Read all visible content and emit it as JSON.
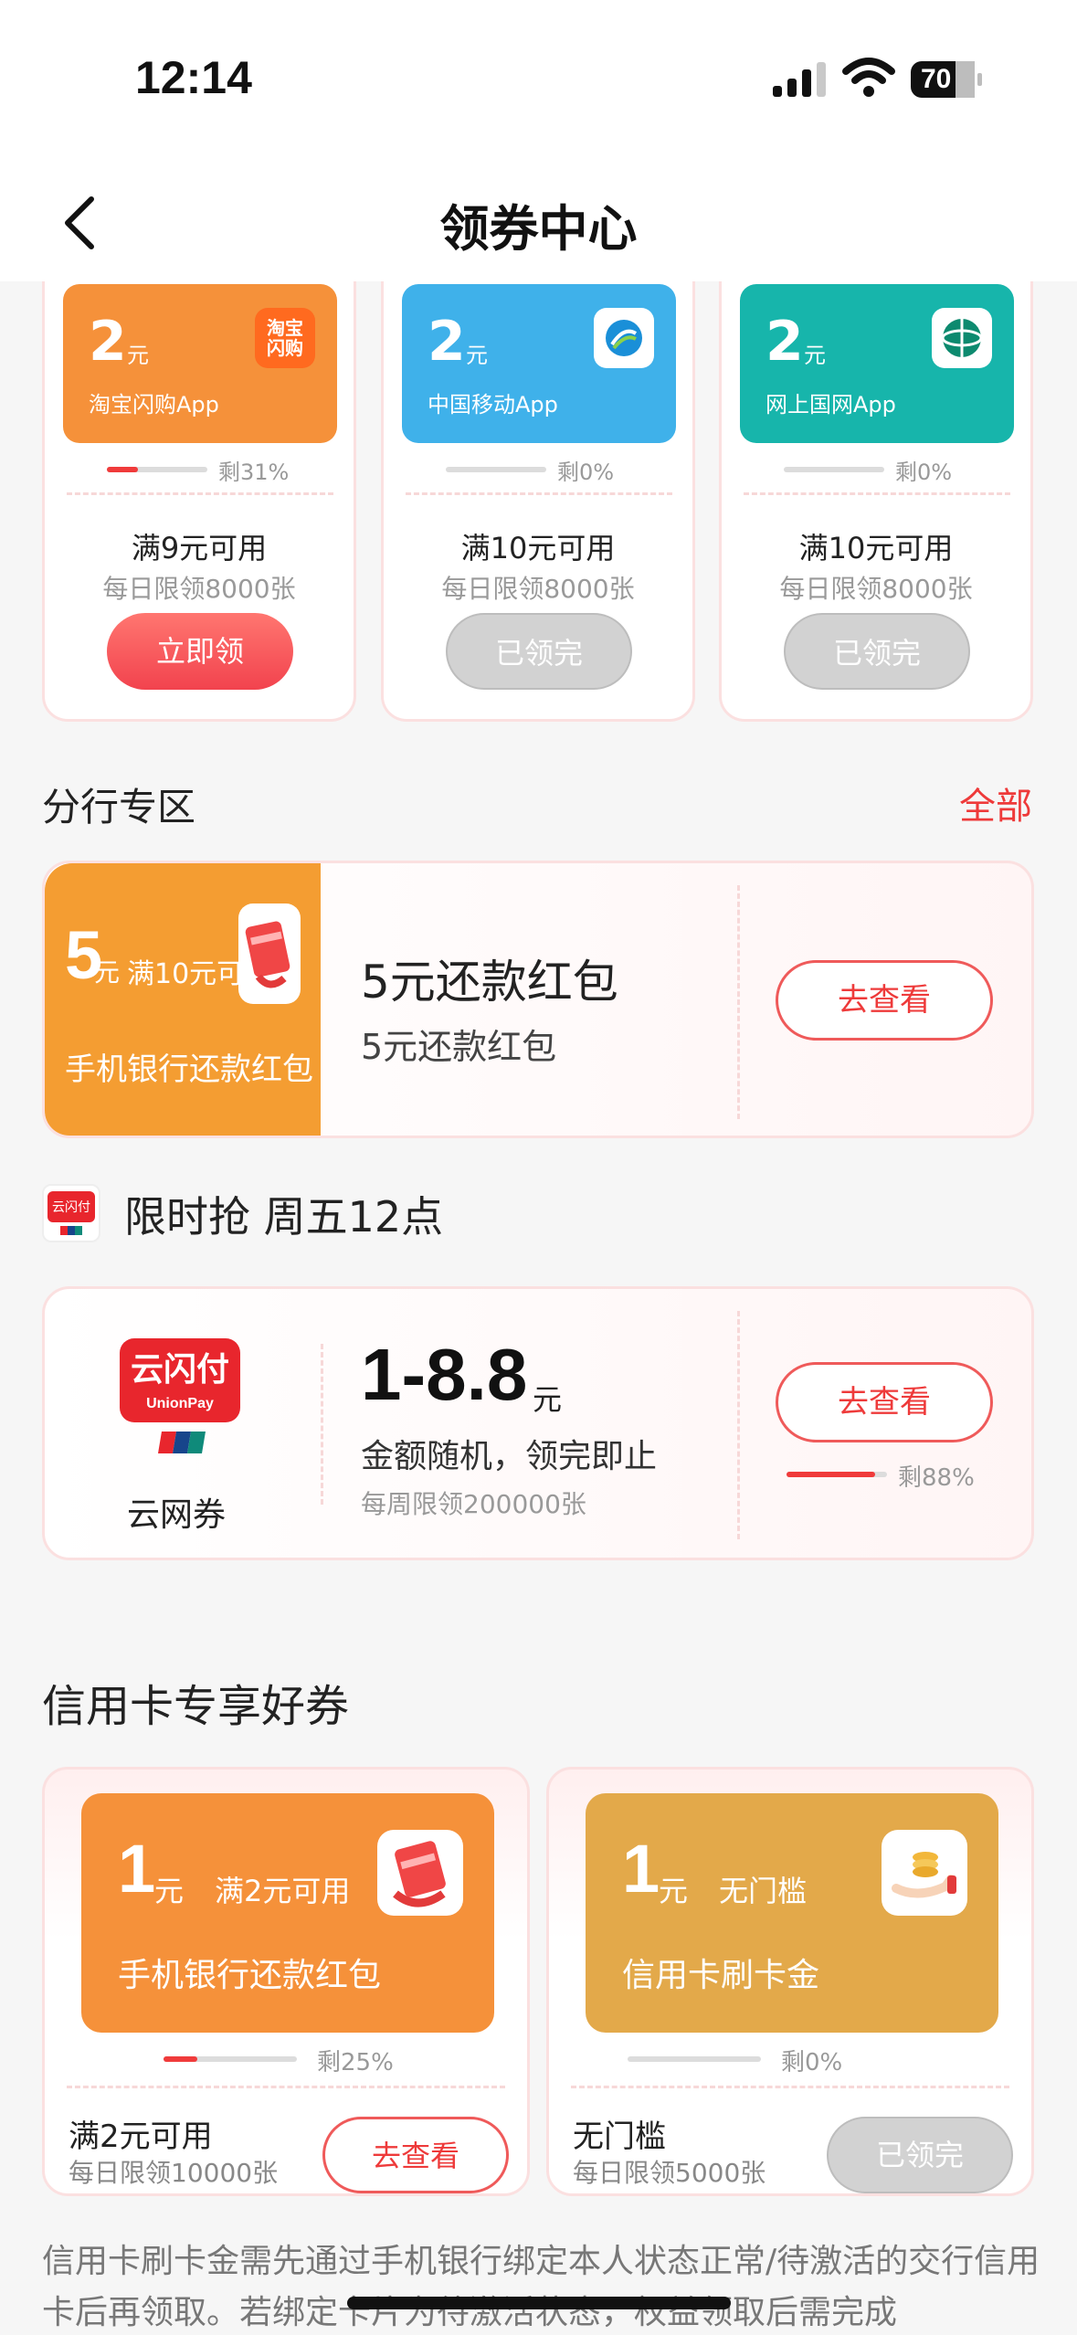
{
  "status_bar": {
    "time": "12:14",
    "battery": "70"
  },
  "nav": {
    "title": "领券中心"
  },
  "top_coupons": [
    {
      "amount": "2",
      "unit": "元",
      "app": "淘宝闪购App",
      "logo_text": "淘宝闪购",
      "remaining": "剩31%",
      "progress": 0.31,
      "condition": "满9元可用",
      "limit": "每日限领8000张",
      "button": "立即领",
      "color": "#f5913a"
    },
    {
      "amount": "2",
      "unit": "元",
      "app": "中国移动App",
      "remaining": "剩0%",
      "progress": 0,
      "condition": "满10元可用",
      "limit": "每日限领8000张",
      "button": "已领完",
      "color": "#3fb1ea"
    },
    {
      "amount": "2",
      "unit": "元",
      "app": "网上国网App",
      "remaining": "剩0%",
      "progress": 0,
      "condition": "满10元可用",
      "limit": "每日限领8000张",
      "button": "已领完",
      "color": "#17b5ab"
    }
  ],
  "branch_section": {
    "title": "分行专区",
    "all_link": "全部",
    "card": {
      "amount": "5",
      "unit": "元",
      "condition": "满10元可用",
      "name": "手机银行还款红包",
      "title": "5元还款红包",
      "subtitle": "5元还款红包",
      "button": "去查看"
    }
  },
  "limited_section": {
    "logo_text": "云闪付",
    "title": "限时抢 周五12点",
    "card": {
      "logo_text": "云闪付",
      "logo_sub": "UnionPay",
      "name": "云网券",
      "amount": "1-8.8",
      "unit": "元",
      "desc": "金额随机，领完即止",
      "limit": "每周限领200000张",
      "button": "去查看",
      "remaining": "剩88%",
      "progress": 0.88
    }
  },
  "credit_section": {
    "title": "信用卡专享好券",
    "cards": [
      {
        "amount": "1",
        "unit": "元",
        "condition_top": "满2元可用",
        "name": "手机银行还款红包",
        "remaining": "剩25%",
        "progress": 0.25,
        "condition": "满2元可用",
        "limit": "每日限领10000张",
        "button": "去查看",
        "color": "#f5913a"
      },
      {
        "amount": "1",
        "unit": "元",
        "condition_top": "无门槛",
        "name": "信用卡刷卡金",
        "remaining": "剩0%",
        "progress": 0,
        "condition": "无门槛",
        "limit": "每日限领5000张",
        "button": "已领完",
        "color": "#e3a94a"
      }
    ],
    "note": "信用卡刷卡金需先通过手机银行绑定本人状态正常/待激活的交行信用卡后再领取。若绑定卡片为待激活状态，权益领取后需完成"
  },
  "colors": {
    "accent": "#ee3a3a",
    "background": "#f6f6f6"
  }
}
